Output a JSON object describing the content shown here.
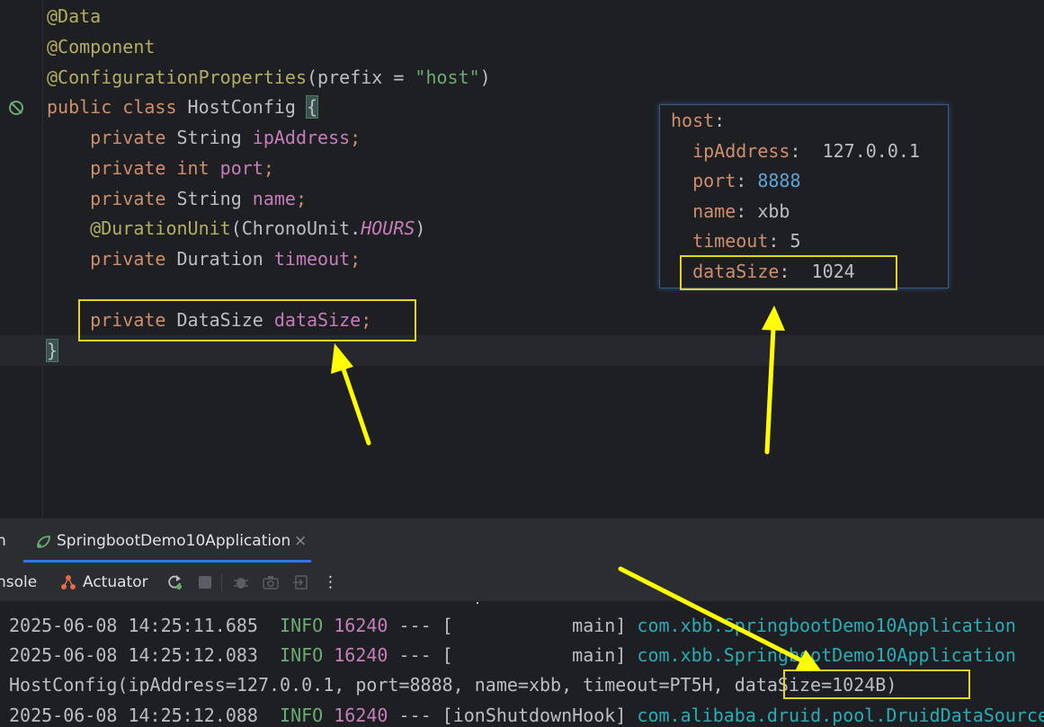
{
  "editor": {
    "lines": [
      {
        "id": "l1",
        "parts": [
          {
            "t": "@Data",
            "c": "ann"
          }
        ]
      },
      {
        "id": "l2",
        "parts": [
          {
            "t": "@Component",
            "c": "ann"
          }
        ]
      },
      {
        "id": "l3",
        "parts": [
          {
            "t": "@ConfigurationProperties",
            "c": "ann"
          },
          {
            "t": "(prefix = ",
            "c": ""
          },
          {
            "t": "\"host\"",
            "c": "str"
          },
          {
            "t": ")",
            "c": ""
          }
        ]
      },
      {
        "id": "l4",
        "parts": [
          {
            "t": "public class ",
            "c": "kw"
          },
          {
            "t": "HostConfig ",
            "c": ""
          },
          {
            "t": "{",
            "c": "brace-hl"
          }
        ]
      },
      {
        "id": "l5",
        "parts": [
          {
            "t": "    private ",
            "c": "kw"
          },
          {
            "t": "String ",
            "c": ""
          },
          {
            "t": "ipAddress",
            "c": "fld"
          },
          {
            "t": ";",
            "c": "kw"
          }
        ]
      },
      {
        "id": "l6",
        "parts": [
          {
            "t": "    private int ",
            "c": "kw"
          },
          {
            "t": "port",
            "c": "fld"
          },
          {
            "t": ";",
            "c": "kw"
          }
        ]
      },
      {
        "id": "l7",
        "parts": [
          {
            "t": "    private ",
            "c": "kw"
          },
          {
            "t": "String ",
            "c": ""
          },
          {
            "t": "name",
            "c": "fld"
          },
          {
            "t": ";",
            "c": "kw"
          }
        ]
      },
      {
        "id": "l8",
        "parts": [
          {
            "t": "    @DurationUnit",
            "c": "ann"
          },
          {
            "t": "(ChronoUnit.",
            "c": ""
          },
          {
            "t": "HOURS",
            "c": "ital"
          },
          {
            "t": ")",
            "c": ""
          }
        ]
      },
      {
        "id": "l9",
        "parts": [
          {
            "t": "    private ",
            "c": "kw"
          },
          {
            "t": "Duration ",
            "c": ""
          },
          {
            "t": "timeout",
            "c": "fld"
          },
          {
            "t": ";",
            "c": "kw"
          }
        ]
      },
      {
        "id": "l10",
        "parts": []
      },
      {
        "id": "l11",
        "parts": [
          {
            "t": "    private ",
            "c": "kw"
          },
          {
            "t": "DataSize ",
            "c": ""
          },
          {
            "t": "dataSize",
            "c": "fld"
          },
          {
            "t": ";",
            "c": "kw"
          }
        ]
      },
      {
        "id": "l12",
        "parts": [
          {
            "t": "}",
            "c": "brace-hl"
          }
        ]
      }
    ]
  },
  "yaml": {
    "lines": [
      {
        "id": "y1",
        "parts": [
          {
            "t": "host",
            "c": "yk"
          },
          {
            "t": ":",
            "c": ""
          }
        ]
      },
      {
        "id": "y2",
        "parts": [
          {
            "t": "  ipAddress",
            "c": "yk"
          },
          {
            "t": ":  127.0.0.1",
            "c": ""
          }
        ]
      },
      {
        "id": "y3",
        "parts": [
          {
            "t": "  port",
            "c": "yk"
          },
          {
            "t": ": ",
            "c": ""
          },
          {
            "t": "8888",
            "c": "yn"
          }
        ]
      },
      {
        "id": "y4",
        "parts": [
          {
            "t": "  name",
            "c": "yk"
          },
          {
            "t": ": xbb",
            "c": ""
          }
        ]
      },
      {
        "id": "y5",
        "parts": [
          {
            "t": "  timeout",
            "c": "yk"
          },
          {
            "t": ": 5",
            "c": ""
          }
        ]
      },
      {
        "id": "y6",
        "parts": [
          {
            "t": "  dataSize",
            "c": "yk"
          },
          {
            "t": ":  1024",
            "c": ""
          }
        ]
      }
    ]
  },
  "run_panel": {
    "left_tab_fragment": "n",
    "tab_label": "SpringbootDemo10Application",
    "tab_close": "×",
    "console_label": "nsole",
    "actuator_label": "Actuator",
    "more": "⋮"
  },
  "console": {
    "lines": [
      {
        "id": "c1",
        "parts": [
          {
            "t": "2025-06-08 14:25:11.685  ",
            "c": ""
          },
          {
            "t": "INFO",
            "c": "lg-info"
          },
          {
            "t": " ",
            "c": ""
          },
          {
            "t": "16240",
            "c": "lg-pid"
          },
          {
            "t": " --- [           main] ",
            "c": ""
          },
          {
            "t": "com.xbb.SpringbootDemo10Application",
            "c": "lg-cls"
          }
        ]
      },
      {
        "id": "c2",
        "parts": [
          {
            "t": "2025-06-08 14:25:12.083  ",
            "c": ""
          },
          {
            "t": "INFO",
            "c": "lg-info"
          },
          {
            "t": " ",
            "c": ""
          },
          {
            "t": "16240",
            "c": "lg-pid"
          },
          {
            "t": " --- [           main] ",
            "c": ""
          },
          {
            "t": "com.xbb.SpringbootDemo10Application",
            "c": "lg-cls"
          }
        ]
      },
      {
        "id": "c3",
        "parts": [
          {
            "t": "HostConfig(ipAddress=127.0.0.1, port=8888, name=xbb, timeout=PT5H, dataSize=1024B)",
            "c": ""
          }
        ]
      },
      {
        "id": "c4",
        "parts": [
          {
            "t": "2025-06-08 14:25:12.088  ",
            "c": ""
          },
          {
            "t": "INFO",
            "c": "lg-info"
          },
          {
            "t": " ",
            "c": ""
          },
          {
            "t": "16240",
            "c": "lg-pid"
          },
          {
            "t": " --- [ionShutdownHook] ",
            "c": ""
          },
          {
            "t": "com.alibaba.druid.pool.DruidDataSource",
            "c": "lg-cls"
          }
        ]
      }
    ]
  },
  "colors": {
    "highlight": "#e8d41b",
    "arrow": "#ffff00"
  }
}
